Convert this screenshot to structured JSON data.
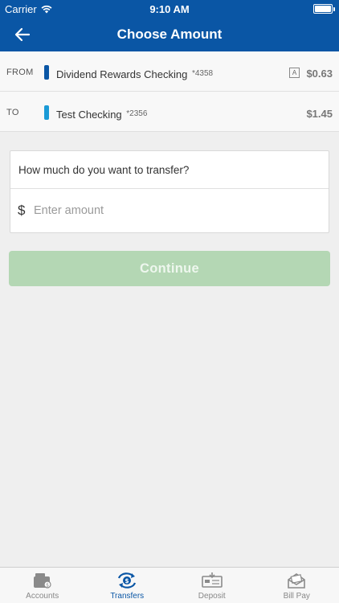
{
  "status_bar": {
    "carrier": "Carrier",
    "time": "9:10 AM"
  },
  "nav": {
    "title": "Choose Amount",
    "back_icon": "arrow-left-icon"
  },
  "from_account": {
    "label": "FROM",
    "name": "Dividend Rewards Checking",
    "suffix": "*4358",
    "available_badge": "A",
    "balance": "$0.63",
    "color": "#0a56a5"
  },
  "to_account": {
    "label": "TO",
    "name": "Test Checking",
    "suffix": "*2356",
    "balance": "$1.45",
    "color": "#1a9ad6"
  },
  "amount": {
    "question": "How much do you want to transfer?",
    "currency_symbol": "$",
    "placeholder": "Enter amount",
    "value": ""
  },
  "continue_button": {
    "label": "Continue",
    "enabled": false,
    "color": "#b4d7b4"
  },
  "tab_bar": {
    "items": [
      {
        "label": "Accounts",
        "icon": "wallet-icon",
        "active": false
      },
      {
        "label": "Transfers",
        "icon": "transfer-icon",
        "active": true
      },
      {
        "label": "Deposit",
        "icon": "check-deposit-icon",
        "active": false
      },
      {
        "label": "Bill Pay",
        "icon": "envelope-icon",
        "active": false
      }
    ]
  }
}
